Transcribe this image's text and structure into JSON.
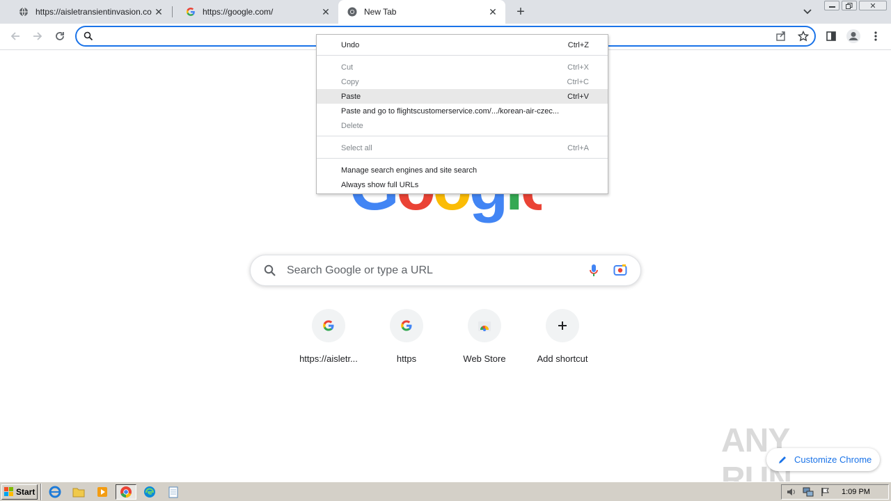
{
  "tabs": [
    {
      "title": "https://aisletransientinvasion.com/d",
      "icon": "globe-icon",
      "active": false
    },
    {
      "title": "https://google.com/",
      "icon": "google-g-icon",
      "active": false
    },
    {
      "title": "New Tab",
      "icon": "chrome-icon",
      "active": true
    }
  ],
  "omnibox": {
    "value": ""
  },
  "context_menu": {
    "items": [
      {
        "label": "Undo",
        "shortcut": "Ctrl+Z",
        "enabled": true
      },
      {
        "label": "Cut",
        "shortcut": "Ctrl+X",
        "enabled": false
      },
      {
        "label": "Copy",
        "shortcut": "Ctrl+C",
        "enabled": false
      },
      {
        "label": "Paste",
        "shortcut": "Ctrl+V",
        "enabled": true,
        "highlighted": true
      },
      {
        "label": "Paste and go to flightscustomerservice.com/.../korean-air-czec...",
        "shortcut": "",
        "enabled": true
      },
      {
        "label": "Delete",
        "shortcut": "",
        "enabled": false
      },
      {
        "label": "Select all",
        "shortcut": "Ctrl+A",
        "enabled": false
      },
      {
        "label": "Manage search engines and site search",
        "shortcut": "",
        "enabled": true
      },
      {
        "label": "Always show full URLs",
        "shortcut": "",
        "enabled": true
      }
    ]
  },
  "ntp": {
    "search_placeholder": "Search Google or type a URL",
    "shortcuts": [
      {
        "label": "https://aisletr...",
        "icon": "google-g-icon"
      },
      {
        "label": "https",
        "icon": "google-g-icon"
      },
      {
        "label": "Web Store",
        "icon": "web-store-icon"
      },
      {
        "label": "Add shortcut",
        "icon": "plus-icon"
      }
    ],
    "customize_label": "Customize Chrome"
  },
  "watermark": "ANY RUN",
  "taskbar": {
    "start_label": "Start",
    "clock": "1:09 PM"
  },
  "colors": {
    "accent": "#1a73e8",
    "tabstrip": "#dee1e6",
    "taskbar": "#d4d0c8"
  }
}
